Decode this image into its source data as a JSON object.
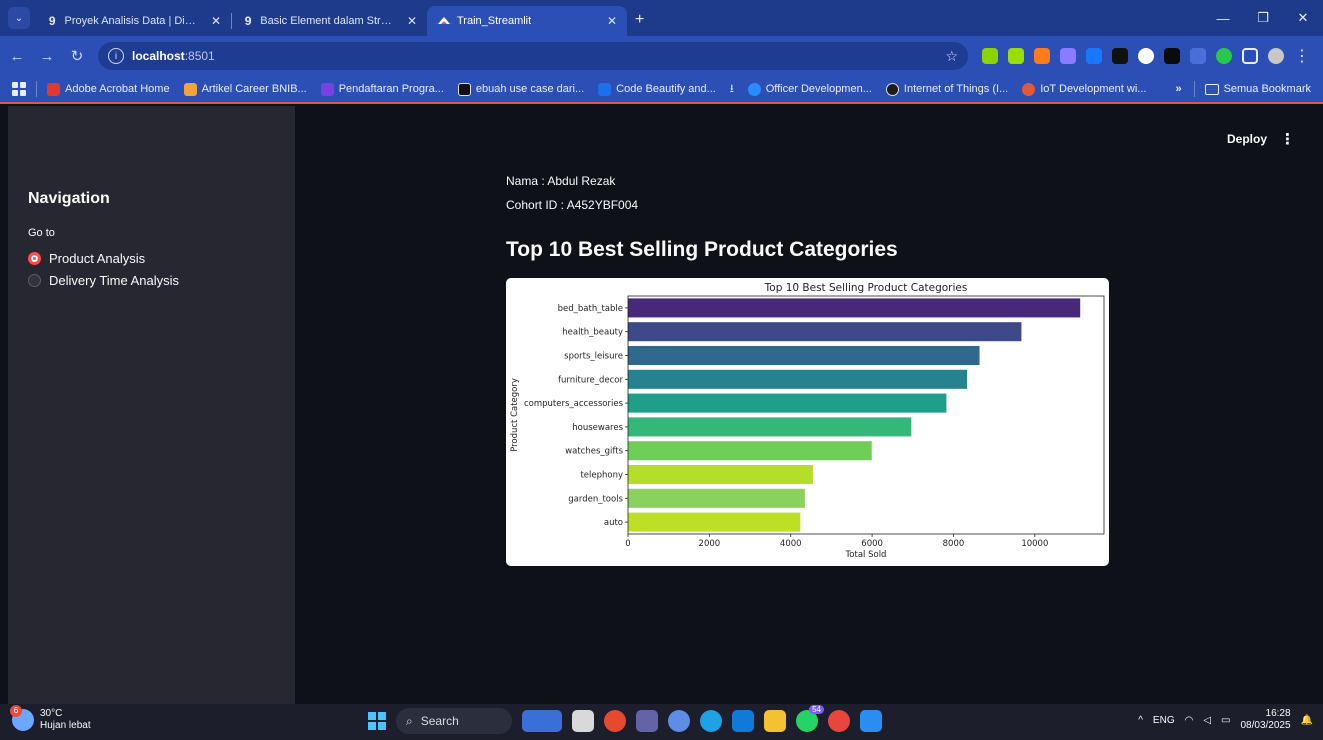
{
  "browser": {
    "tabs": [
      {
        "label": "Proyek Analisis Data | Dicoding",
        "icon": "dicoding-icon",
        "active": false
      },
      {
        "label": "Basic Element dalam Streamlit |",
        "icon": "dicoding-icon",
        "active": false
      },
      {
        "label": "Train_Streamlit",
        "icon": "streamlit-icon",
        "active": true
      }
    ],
    "tab_close_glyph": "✕",
    "new_tab_glyph": "+",
    "address": {
      "host": "localhost",
      "port": ":8501"
    },
    "bookmarks": [
      {
        "label": "Adobe Acrobat Home",
        "color": "#e03a2f"
      },
      {
        "label": "Artikel Career BNIB...",
        "color": "#f2a33a"
      },
      {
        "label": "Pendaftaran Progra...",
        "color": "#7b3fe4"
      },
      {
        "label": "ebuah use case dari...",
        "color": "#111111"
      },
      {
        "label": "Code Beautify and...",
        "color": "#1f6feb"
      },
      {
        "label": "",
        "color": "#e8eeff"
      },
      {
        "label": "Officer Developmen...",
        "color": "#2b8aff"
      },
      {
        "label": "Internet of Things (I...",
        "color": "#1c1c1c"
      },
      {
        "label": "IoT Development wi...",
        "color": "#e05a3a"
      }
    ],
    "bookmark_more": "»",
    "bookmark_folder": "Semua Bookmark"
  },
  "app": {
    "deploy_label": "Deploy",
    "sidebar": {
      "title": "Navigation",
      "radio_label": "Go to",
      "options": [
        {
          "label": "Product Analysis",
          "selected": true
        },
        {
          "label": "Delivery Time Analysis",
          "selected": false
        }
      ]
    },
    "main": {
      "name_line": "Nama : Abdul Rezak",
      "cohort_line": "Cohort ID : A452YBF004",
      "heading": "Top 10 Best Selling Product Categories"
    }
  },
  "chart_data": {
    "type": "bar",
    "orientation": "horizontal",
    "title": "Top 10 Best Selling Product Categories",
    "xlabel": "Total Sold",
    "ylabel": "Product Category",
    "categories": [
      "bed_bath_table",
      "health_beauty",
      "sports_leisure",
      "furniture_decor",
      "computers_accessories",
      "housewares",
      "watches_gifts",
      "telephony",
      "garden_tools",
      "auto"
    ],
    "values": [
      11115,
      9670,
      8641,
      8334,
      7827,
      6964,
      5991,
      4545,
      4347,
      4235
    ],
    "colors": [
      "#482878",
      "#3e4989",
      "#31688e",
      "#26828e",
      "#1f9e89",
      "#35b779",
      "#6ece58",
      "#b5de2b",
      "#8bd15d",
      "#bddf26"
    ],
    "xlim": [
      0,
      11700
    ],
    "xticks": [
      0,
      2000,
      4000,
      6000,
      8000,
      10000
    ],
    "grid": false
  },
  "taskbar": {
    "weather_temp": "30°C",
    "weather_desc": "Hujan lebat",
    "weather_badge": "6",
    "search_label": "Search",
    "whatsapp_badge": "54",
    "lang": "ENG",
    "time": "16:28",
    "date": "08/03/2025"
  }
}
